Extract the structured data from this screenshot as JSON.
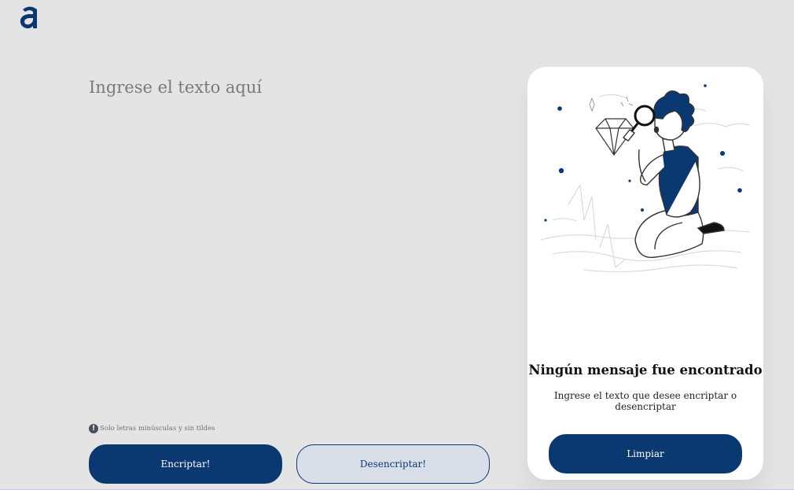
{
  "input": {
    "placeholder": "Ingrese el texto aquí",
    "value": ""
  },
  "hint": {
    "icon": "exclamation-circle-icon",
    "text": "Solo letras minúsculas y sin tildes"
  },
  "buttons": {
    "encrypt_label": "Encriptar!",
    "decrypt_label": "Desencriptar!"
  },
  "output": {
    "illustration": "person-with-magnifying-glass-illustration",
    "title": "Ningún mensaje fue encontrado",
    "text": "Ingrese el texto que desee encriptar o desencriptar",
    "clear_label": "Limpiar"
  },
  "colors": {
    "primary": "#0a3871",
    "background": "#e4e4e5",
    "panel": "#ffffff",
    "secondary_button": "#d8dfe8"
  }
}
